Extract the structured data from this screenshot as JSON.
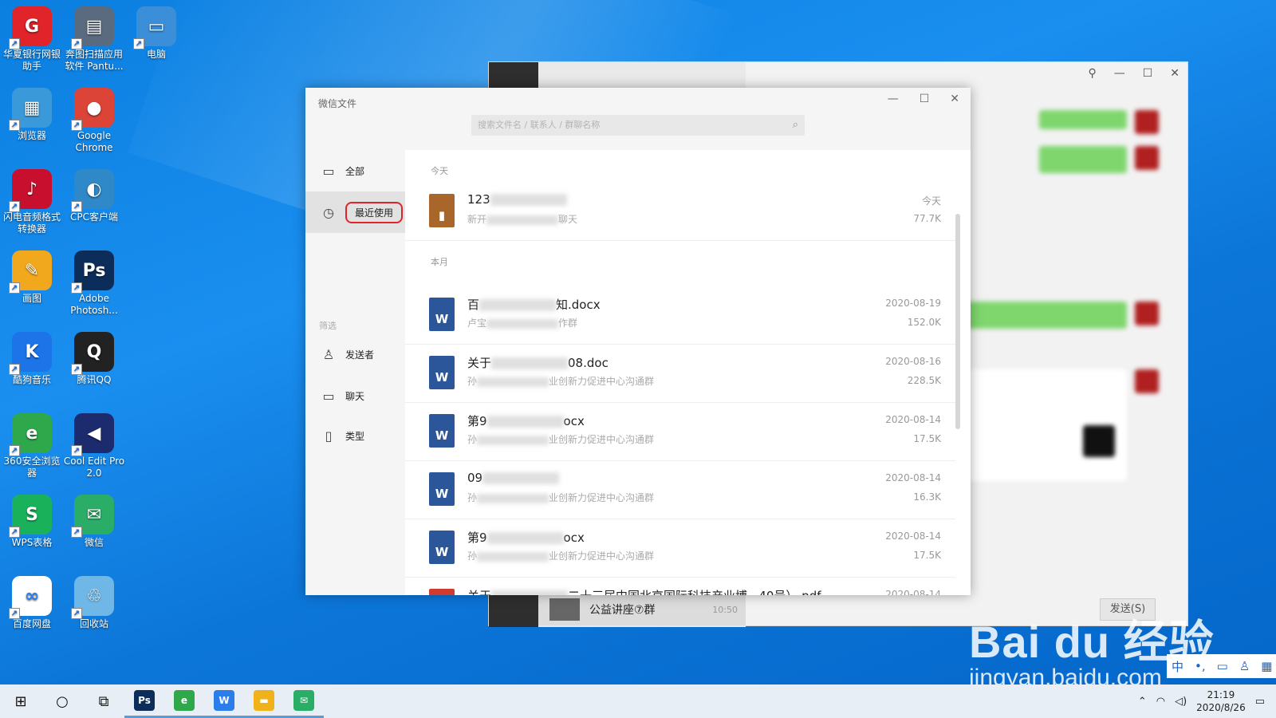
{
  "desktop": {
    "icons": [
      {
        "label": "华夏银行网银助手",
        "glyph": "G",
        "color": "#e0242a"
      },
      {
        "label": "奔图扫描应用软件 Pantu...",
        "glyph": "▤",
        "color": "#5a6b80"
      },
      {
        "label": "电脑",
        "glyph": "▭",
        "color": "#3b8ed8"
      },
      {
        "label": "浏览器",
        "glyph": "▦",
        "color": "#3a9ad9"
      },
      {
        "label": "Google Chrome",
        "glyph": "●",
        "color": "#db4437"
      },
      {
        "label": "闪电音频格式转换器",
        "glyph": "♪",
        "color": "#c8102e"
      },
      {
        "label": "CPC客户端",
        "glyph": "◐",
        "color": "#2f88c8"
      },
      {
        "label": "画图",
        "glyph": "✎",
        "color": "#f2a81d"
      },
      {
        "label": "Adobe Photosh...",
        "glyph": "Ps",
        "color": "#0c2d5a"
      },
      {
        "label": "酷狗音乐",
        "glyph": "K",
        "color": "#1d74e8"
      },
      {
        "label": "腾讯QQ",
        "glyph": "Q",
        "color": "#222222"
      },
      {
        "label": "360安全浏览器",
        "glyph": "e",
        "color": "#2ea84b"
      },
      {
        "label": "Cool Edit Pro 2.0",
        "glyph": "◀",
        "color": "#1c2b6e"
      },
      {
        "label": "WPS表格",
        "glyph": "S",
        "color": "#19b25a"
      },
      {
        "label": "微信",
        "glyph": "✉",
        "color": "#2aae67"
      },
      {
        "label": "百度网盘",
        "glyph": "∞",
        "color": "#ffffff"
      },
      {
        "label": "回收站",
        "glyph": "♲",
        "color": "#6fb7e6"
      }
    ]
  },
  "chat_window": {
    "chat_name": "公益讲座⑦群",
    "chat_time": "10:50",
    "send_label": "发送(S)"
  },
  "files_window": {
    "title": "微信文件",
    "search_placeholder": "搜索文件名 / 联系人 / 群聊名称",
    "sidebar": {
      "all": "全部",
      "recent": "最近使用",
      "filter_heading": "筛选",
      "sender": "发送者",
      "chat": "聊天",
      "type": "类型"
    },
    "sections": {
      "today": "今天",
      "this_month": "本月"
    },
    "files": [
      {
        "name": "123",
        "sub": "新开",
        "sub_tail": "聊天",
        "date": "今天",
        "size": "77.7K",
        "kind": "zip",
        "badge": "▮"
      },
      {
        "name": "百",
        "name_tail": "知.docx",
        "sub": "卢宝",
        "sub_tail": "作群",
        "date": "2020-08-19",
        "size": "152.0K",
        "kind": "word",
        "badge": "W"
      },
      {
        "name": "关于",
        "name_tail": "08.doc",
        "sub": "孙",
        "sub_tail": "业创新力促进中心沟通群",
        "date": "2020-08-16",
        "size": "228.5K",
        "kind": "word",
        "badge": "W"
      },
      {
        "name": "第9",
        "name_tail": "ocx",
        "sub": "孙",
        "sub_tail": "业创新力促进中心沟通群",
        "date": "2020-08-14",
        "size": "17.5K",
        "kind": "word",
        "badge": "W"
      },
      {
        "name": "09",
        "name_tail": "",
        "sub": "孙",
        "sub_tail": "业创新力促进中心沟通群",
        "date": "2020-08-14",
        "size": "16.3K",
        "kind": "word",
        "badge": "W"
      },
      {
        "name": "第9",
        "name_tail": "ocx",
        "sub": "孙",
        "sub_tail": "业创新力促进中心沟通群",
        "date": "2020-08-14",
        "size": "17.5K",
        "kind": "word",
        "badge": "W"
      },
      {
        "name": "关于",
        "name_tail": "二十三届中国北京国际科技产业博...40号）.pdf",
        "sub": "",
        "sub_tail": "",
        "date": "2020-08-14",
        "size": "",
        "kind": "pdf",
        "badge": ""
      }
    ]
  },
  "watermark": {
    "brand": "Bai du 经验",
    "url": "jingyan.baidu.com"
  },
  "ime": {
    "lang": "中"
  },
  "taskbar": {
    "time": "21:19",
    "date": "2020/8/26"
  }
}
